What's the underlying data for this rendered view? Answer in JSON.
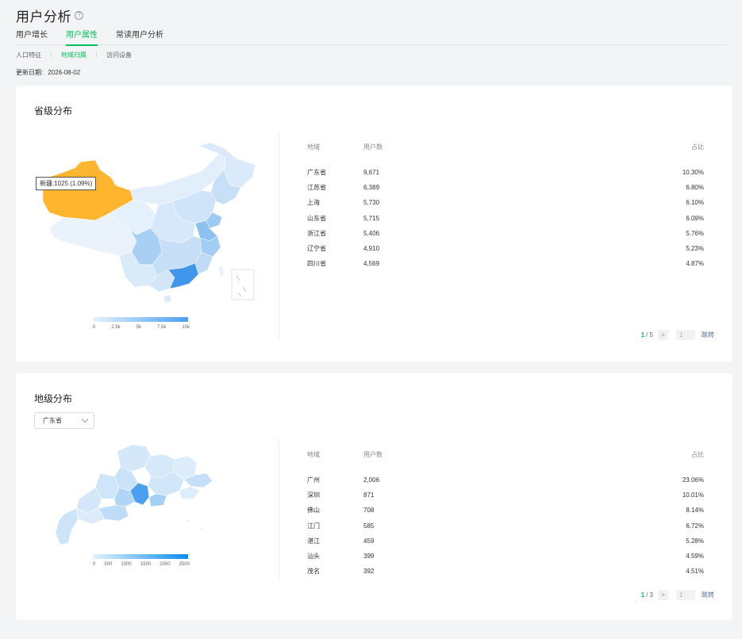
{
  "header": {
    "title": "用户分析",
    "help_icon": "?"
  },
  "tabs": [
    {
      "label": "用户增长",
      "active": false
    },
    {
      "label": "用户属性",
      "active": true
    },
    {
      "label": "常读用户分析",
      "active": false
    }
  ],
  "subtabs": [
    {
      "label": "人口特征",
      "active": false
    },
    {
      "label": "地域归属",
      "active": true
    },
    {
      "label": "访问设备",
      "active": false
    }
  ],
  "update": {
    "label": "更新日期:",
    "date": "2026-08-02"
  },
  "province_card": {
    "title": "省级分布",
    "tooltip": "新疆:1025 (1.09%)",
    "legend_labels": [
      "0",
      "2.5k",
      "5k",
      "7.5k",
      "10k"
    ],
    "columns": [
      "地域",
      "用户数",
      "占比"
    ],
    "rows": [
      {
        "region": "广东省",
        "users": "9,671",
        "ratio": "10.30%"
      },
      {
        "region": "江苏省",
        "users": "6,389",
        "ratio": "6.80%"
      },
      {
        "region": "上海",
        "users": "5,730",
        "ratio": "6.10%"
      },
      {
        "region": "山东省",
        "users": "5,715",
        "ratio": "6.09%"
      },
      {
        "region": "浙江省",
        "users": "5,406",
        "ratio": "5.76%"
      },
      {
        "region": "辽宁省",
        "users": "4,910",
        "ratio": "5.23%"
      },
      {
        "region": "四川省",
        "users": "4,569",
        "ratio": "4.87%"
      }
    ],
    "pager": {
      "current": "1",
      "total": "/ 5",
      "next": ">",
      "input": "1",
      "jump": "跳转"
    }
  },
  "city_card": {
    "title": "地级分布",
    "select_value": "广东省",
    "legend_labels": [
      "0",
      "500",
      "1000",
      "1500",
      "2000",
      "2500"
    ],
    "columns": [
      "地域",
      "用户数",
      "占比"
    ],
    "rows": [
      {
        "region": "广州",
        "users": "2,006",
        "ratio": "23.06%"
      },
      {
        "region": "深圳",
        "users": "871",
        "ratio": "10.01%"
      },
      {
        "region": "佛山",
        "users": "708",
        "ratio": "8.14%"
      },
      {
        "region": "江门",
        "users": "585",
        "ratio": "6.72%"
      },
      {
        "region": "湛江",
        "users": "459",
        "ratio": "5.28%"
      },
      {
        "region": "汕头",
        "users": "399",
        "ratio": "4.59%"
      },
      {
        "region": "茂名",
        "users": "392",
        "ratio": "4.51%"
      }
    ],
    "pager": {
      "current": "1",
      "total": "/ 3",
      "next": ">",
      "input": "1",
      "jump": "跳转"
    }
  },
  "colors": {
    "accent": "#07c160",
    "highlight": "#ffb52e",
    "map_low": "#dcecfa",
    "map_high": "#4a9ff0"
  }
}
